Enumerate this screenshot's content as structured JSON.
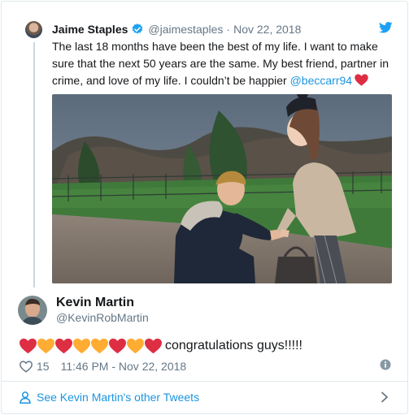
{
  "quoted_tweet": {
    "author_name": "Jaime Staples",
    "author_handle": "@jaimestaples",
    "separator": "·",
    "date": "Nov 22, 2018",
    "text": "The last 18 months have been the best of my life. I want to make sure that the next 50 years are the same. My best friend, partner in crime, and love of my life. I couldn’t be happier ",
    "mention": "@beccarr94",
    "icons": {
      "verified": "verified-badge-icon",
      "platform": "twitter-bird-icon",
      "end_emoji": "red-heart-icon"
    }
  },
  "reply_tweet": {
    "author_name": "Kevin Martin",
    "author_handle": "@KevinRobMartin",
    "emojis": [
      "red-heart",
      "yellow-heart",
      "red-heart",
      "yellow-heart",
      "yellow-heart",
      "red-heart",
      "yellow-heart",
      "red-heart"
    ],
    "text": "congratulations guys!!!!!",
    "like_count": "15",
    "timestamp": "11:46 PM - Nov 22, 2018"
  },
  "footer": {
    "link_text": "See Kevin Martin's other Tweets"
  },
  "colors": {
    "link_blue": "#1b95e0",
    "muted_gray": "#657786",
    "border": "#e1e8ed",
    "heart_red": "#e0245e",
    "heart_yellow": "#ffac33"
  }
}
